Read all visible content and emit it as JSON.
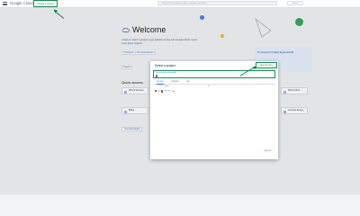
{
  "topbar": {
    "brand": "Google Cloud",
    "create_project_label": "Create a project",
    "search_placeholder": "Search (/) for resources, docs, products, and more",
    "search_button": "Search"
  },
  "welcome": {
    "title": "Welcome",
    "subtitle_pre": "Create or select a project to get started running with Google Cloud.",
    "subtitle_link": "Learn more about projects",
    "chips": [
      "Dashboard",
      "Recommendations"
    ],
    "side_chip": "Explore",
    "quick_access_title": "Quick access",
    "quick_access_items": [
      "APIs & Services",
      "IAM & Admin",
      "Billing",
      "Compute Engine",
      "Cloud Storage",
      "BigQuery",
      "VPC network",
      "Kubernetes Engine"
    ],
    "view_all_label": "View all products",
    "promo_text": "Try Gemini 2.0 Flash Experimental"
  },
  "dialog": {
    "title": "Select a project",
    "new_project_label": "NEW PROJECT",
    "search_label": "Search projects and folders",
    "tabs": [
      "RECENT",
      "STARRED",
      "ALL"
    ],
    "columns": [
      "Name",
      "ID"
    ],
    "rows": [
      {
        "name": "No org"
      }
    ],
    "cancel_label": "CANCEL"
  },
  "colors": {
    "highlight": "#0d904f",
    "link": "#1a73e8",
    "background": "#f1f3f4"
  }
}
